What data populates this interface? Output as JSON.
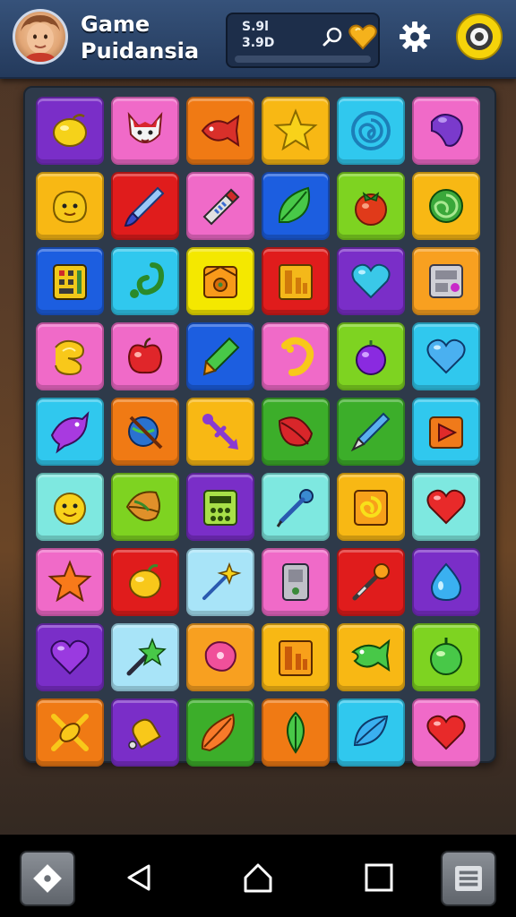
{
  "header": {
    "title_line1": "Game",
    "title_line2": "Puidansia",
    "stat1": "S.9l",
    "stat2": "3.9D"
  },
  "colors": {
    "purple": "#7a2ec8",
    "pink": "#f06ac8",
    "orange": "#f07a14",
    "yellow": "#f8b814",
    "cyan": "#30c8ee",
    "red": "#e01c1c",
    "blue": "#1c5ee0",
    "green": "#3cae2a",
    "lime": "#7ed321",
    "brightyellow": "#f4e800",
    "aqua": "#7ee8e0",
    "lightcyan": "#a8e4f8",
    "lightorange": "#f8a020",
    "teal": "#2ab8c8"
  },
  "board": {
    "rows": [
      [
        {
          "bg": "purple",
          "icon": "lemon"
        },
        {
          "bg": "pink",
          "icon": "fox-face"
        },
        {
          "bg": "orange",
          "icon": "red-fish"
        },
        {
          "bg": "yellow",
          "icon": "star"
        },
        {
          "bg": "cyan",
          "icon": "spiral"
        },
        {
          "bg": "pink",
          "icon": "purple-blob"
        }
      ],
      [
        {
          "bg": "yellow",
          "icon": "smiley"
        },
        {
          "bg": "red",
          "icon": "paintbrush"
        },
        {
          "bg": "pink",
          "icon": "wand"
        },
        {
          "bg": "blue",
          "icon": "leaf"
        },
        {
          "bg": "lime",
          "icon": "tomato"
        },
        {
          "bg": "yellow",
          "icon": "green-swirl"
        }
      ],
      [
        {
          "bg": "blue",
          "icon": "calculator"
        },
        {
          "bg": "cyan",
          "icon": "hook"
        },
        {
          "bg": "brightyellow",
          "icon": "box"
        },
        {
          "bg": "red",
          "icon": "chart"
        },
        {
          "bg": "purple",
          "icon": "heart-cyan"
        },
        {
          "bg": "lightorange",
          "icon": "device"
        }
      ],
      [
        {
          "bg": "pink",
          "icon": "yellow-swirl"
        },
        {
          "bg": "pink",
          "icon": "apple"
        },
        {
          "bg": "blue",
          "icon": "crayon"
        },
        {
          "bg": "pink",
          "icon": "yellow-hook"
        },
        {
          "bg": "lime",
          "icon": "plum"
        },
        {
          "bg": "cyan",
          "icon": "heart-blue"
        }
      ],
      [
        {
          "bg": "cyan",
          "icon": "purple-fish"
        },
        {
          "bg": "orange",
          "icon": "globe-pen"
        },
        {
          "bg": "yellow",
          "icon": "purple-tool"
        },
        {
          "bg": "green",
          "icon": "red-leaf"
        },
        {
          "bg": "green",
          "icon": "blue-pen"
        },
        {
          "bg": "cyan",
          "icon": "triangle"
        }
      ],
      [
        {
          "bg": "aqua",
          "icon": "smiley-yellow"
        },
        {
          "bg": "lime",
          "icon": "leaf-orange"
        },
        {
          "bg": "purple",
          "icon": "calculator-green"
        },
        {
          "bg": "aqua",
          "icon": "pin-pen"
        },
        {
          "bg": "yellow",
          "icon": "swirl-orange"
        },
        {
          "bg": "aqua",
          "icon": "heart-red"
        }
      ],
      [
        {
          "bg": "pink",
          "icon": "star-orange"
        },
        {
          "bg": "red",
          "icon": "lemon-yellow"
        },
        {
          "bg": "lightcyan",
          "icon": "sparkle-wand"
        },
        {
          "bg": "pink",
          "icon": "device-gray"
        },
        {
          "bg": "red",
          "icon": "wand-dark"
        },
        {
          "bg": "purple",
          "icon": "blue-drop"
        }
      ],
      [
        {
          "bg": "purple",
          "icon": "heart-purple"
        },
        {
          "bg": "lightcyan",
          "icon": "star-wand"
        },
        {
          "bg": "lightorange",
          "icon": "pink-blob"
        },
        {
          "bg": "yellow",
          "icon": "chart-orange"
        },
        {
          "bg": "yellow",
          "icon": "green-fish"
        },
        {
          "bg": "lime",
          "icon": "green-ball"
        }
      ],
      [
        {
          "bg": "orange",
          "icon": "orange-bow"
        },
        {
          "bg": "purple",
          "icon": "bell"
        },
        {
          "bg": "green",
          "icon": "orange-leaf"
        },
        {
          "bg": "orange",
          "icon": "green-leaf"
        },
        {
          "bg": "cyan",
          "icon": "blue-leaf"
        },
        {
          "bg": "pink",
          "icon": "heart-red2"
        }
      ]
    ]
  }
}
